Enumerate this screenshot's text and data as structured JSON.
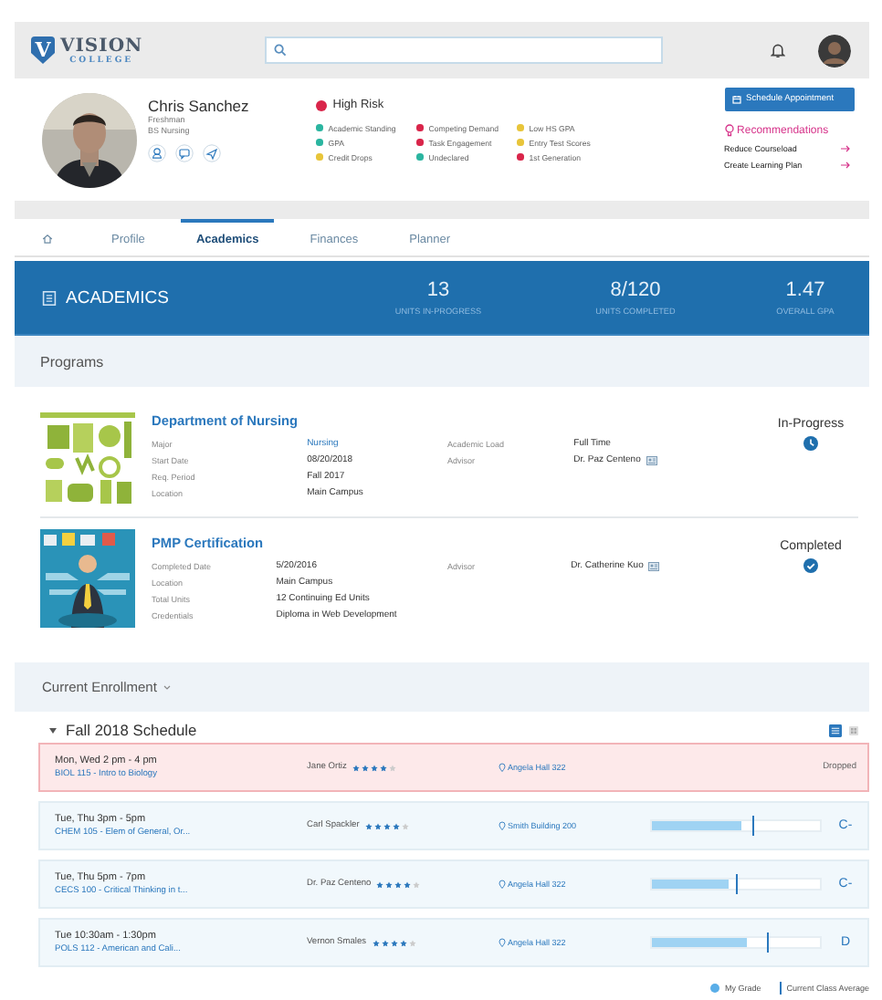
{
  "header": {
    "logo": {
      "mark": "V",
      "name": "VISION",
      "subtitle": "COLLEGE"
    }
  },
  "student": {
    "name": "Chris Sanchez",
    "details": [
      "Freshman",
      "BS Nursing"
    ]
  },
  "risk": {
    "label": "High Risk",
    "color": "#d9254a",
    "factors": [
      {
        "label": "Academic Standing",
        "color": "#2bb5a0"
      },
      {
        "label": "GPA",
        "color": "#2bb5a0"
      },
      {
        "label": "Credit Drops",
        "color": "#e8c53a"
      },
      {
        "label": "Competing Demand",
        "color": "#d9254a"
      },
      {
        "label": "Task Engagement",
        "color": "#d9254a"
      },
      {
        "label": "Undeclared",
        "color": "#2bb5a0"
      },
      {
        "label": "Low HS GPA",
        "color": "#e8c53a"
      },
      {
        "label": "Entry Test Scores",
        "color": "#e8c53a"
      },
      {
        "label": "1st Generation",
        "color": "#d9254a"
      }
    ]
  },
  "schedule_button": "Schedule Appointment",
  "recommendations": {
    "title": "Recommendations",
    "items": [
      "Reduce Courseload",
      "Create Learning Plan"
    ]
  },
  "tabs": [
    {
      "kind": "home",
      "selected": false
    },
    {
      "kind": "text",
      "label": "Profile",
      "selected": false
    },
    {
      "kind": "text",
      "label": "Academics",
      "selected": true
    },
    {
      "kind": "text",
      "label": "Finances",
      "selected": false
    },
    {
      "kind": "text",
      "label": "Planner",
      "selected": false
    }
  ],
  "summary": {
    "title": "ACADEMICS",
    "stats": [
      {
        "value": "13",
        "label": "UNITS IN-PROGRESS"
      },
      {
        "value": "8/120",
        "label": "UNITS COMPLETED"
      },
      {
        "value": "1.47",
        "label": "OVERALL GPA"
      }
    ]
  },
  "programs": {
    "title": "Programs",
    "items": [
      {
        "title": "Department of Nursing",
        "status": {
          "kind": "in_progress",
          "label": "In-Progress"
        },
        "fields": [
          {
            "label": "Major",
            "value": "Nursing",
            "kind": "link"
          },
          {
            "label": "Start Date",
            "value": "08/20/2018",
            "kind": "text"
          },
          {
            "label": "Req. Period",
            "value": "Fall 2017",
            "kind": "text"
          },
          {
            "label": "Location",
            "value": "Main Campus",
            "kind": "text"
          }
        ],
        "side_fields": [
          {
            "label": "Academic Load",
            "value": "Full Time",
            "kind": "text"
          },
          {
            "label": "Advisor",
            "value": "Dr. Paz Centeno",
            "kind": "advisor"
          }
        ]
      },
      {
        "title": "PMP Certification",
        "status": {
          "kind": "completed",
          "label": "Completed"
        },
        "fields": [
          {
            "label": "Completed Date",
            "value": "5/20/2016",
            "kind": "text"
          },
          {
            "label": "Location",
            "value": "Main Campus",
            "kind": "text"
          },
          {
            "label": "Total Units",
            "value": "12 Continuing Ed Units",
            "kind": "text"
          },
          {
            "label": "Credentials",
            "value": "Diploma in Web Development",
            "kind": "text"
          }
        ],
        "side_fields": [
          {
            "label": "Advisor",
            "value": "Dr. Catherine Kuo",
            "kind": "advisor"
          }
        ]
      }
    ]
  },
  "enrollment": {
    "title": "Current Enrollment",
    "term": "Fall 2018 Schedule",
    "views": [
      {
        "kind": "list",
        "selected": true
      },
      {
        "kind": "grid",
        "selected": false
      }
    ],
    "courses": [
      {
        "kind": "dropped",
        "time": "Mon, Wed 2 pm - 4 pm",
        "course": "BIOL 115 - Intro to Biology",
        "instructor": "Jane Ortiz",
        "stars": 4,
        "location": "Angela Hall 322",
        "note": "Dropped"
      },
      {
        "kind": "graded",
        "time": "Tue, Thu 3pm - 5pm",
        "course": "CHEM 105 - Elem of General, Or...",
        "instructor": "Carl Spackler",
        "stars": 4,
        "location": "Smith Building 200",
        "level": 0.53,
        "class_average": {
          "level": 0.6
        },
        "grade": "C-"
      },
      {
        "kind": "graded",
        "time": "Tue, Thu 5pm - 7pm",
        "course": "CECS 100 - Critical Thinking in t...",
        "instructor": "Dr. Paz Centeno",
        "stars": 4,
        "location": "Angela Hall 322",
        "level": 0.46,
        "class_average": {
          "level": 0.5
        },
        "grade": "C-"
      },
      {
        "kind": "graded",
        "time": "Tue 10:30am - 1:30pm",
        "course": "POLS 112 - American and Cali...",
        "instructor": "Vernon Smales",
        "stars": 4,
        "location": "Angela Hall 322",
        "level": 0.56,
        "class_average": {
          "level": 0.69
        },
        "grade": "D"
      }
    ],
    "legend": [
      "My Grade",
      "Current Class Average"
    ]
  }
}
